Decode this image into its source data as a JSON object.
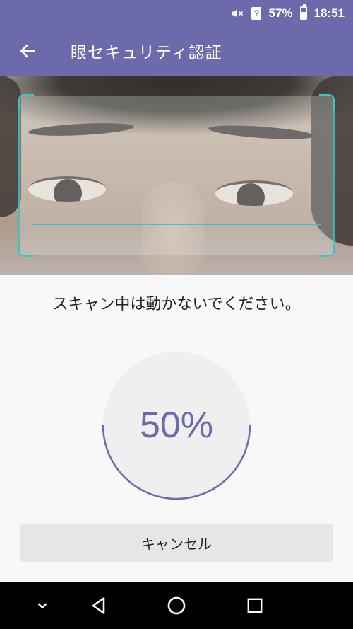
{
  "status_bar": {
    "battery_text": "57%",
    "time": "18:51",
    "sim_label": "?",
    "battery_level": 0.57,
    "icons": [
      "mute-icon",
      "sim-icon",
      "battery-icon"
    ]
  },
  "app_bar": {
    "title": "眼セキュリティ認証",
    "back_icon": "arrow-left-icon"
  },
  "instruction": "スキャン中は動かないでください。",
  "progress": {
    "label": "50%",
    "value": 0.5
  },
  "cancel_label": "キャンセル",
  "nav_bar": {
    "icons": [
      "chevron-down-icon",
      "back-triangle-icon",
      "home-circle-icon",
      "recents-square-icon"
    ]
  },
  "colors": {
    "primary": "#6c6aaa",
    "scan_frame": "#37c7c4",
    "track": "#efefef"
  }
}
